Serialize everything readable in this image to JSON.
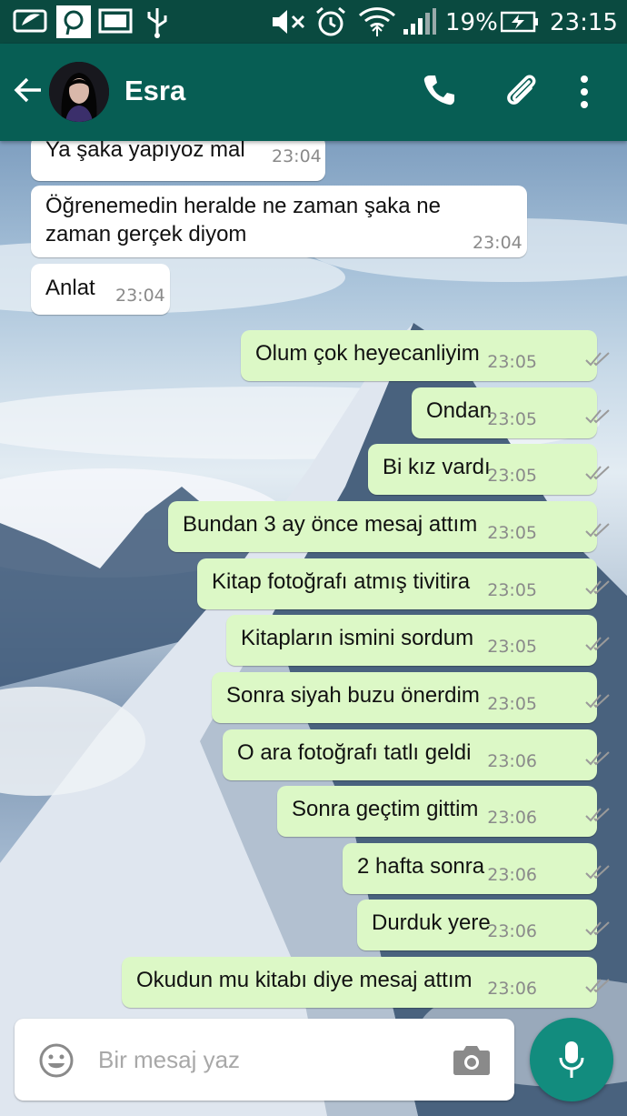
{
  "status_bar": {
    "battery": "19%",
    "time": "23:15"
  },
  "header": {
    "contact_name": "Esra"
  },
  "messages": [
    {
      "dir": "in",
      "text": "Ya şaka yapıyoz mal",
      "time": "23:04"
    },
    {
      "dir": "in",
      "text": "Öğrenemedin heralde ne zaman şaka ne",
      "text2": "zaman gerçek diyom",
      "time": "23:04"
    },
    {
      "dir": "in",
      "text": "Anlat",
      "time": "23:04"
    },
    {
      "dir": "out",
      "text": "Olum çok heyecanliyim",
      "time": "23:05"
    },
    {
      "dir": "out",
      "text": "Ondan",
      "time": "23:05"
    },
    {
      "dir": "out",
      "text": "Bi kız vardı",
      "time": "23:05"
    },
    {
      "dir": "out",
      "text": "Bundan 3 ay önce mesaj attım",
      "time": "23:05"
    },
    {
      "dir": "out",
      "text": "Kitap fotoğrafı atmış tivitira",
      "time": "23:05"
    },
    {
      "dir": "out",
      "text": "Kitapların ismini sordum",
      "time": "23:05"
    },
    {
      "dir": "out",
      "text": "Sonra siyah buzu önerdim",
      "time": "23:05"
    },
    {
      "dir": "out",
      "text": "O ara fotoğrafı tatlı  geldi",
      "time": "23:06"
    },
    {
      "dir": "out",
      "text": "Sonra geçtim gittim",
      "time": "23:06"
    },
    {
      "dir": "out",
      "text": "2 hafta sonra",
      "time": "23:06"
    },
    {
      "dir": "out",
      "text": "Durduk yere",
      "time": "23:06"
    },
    {
      "dir": "out",
      "text": "Okudun mu kitabı diye mesaj attım",
      "time": "23:06"
    }
  ],
  "composer": {
    "placeholder": "Bir mesaj yaz"
  },
  "icons": {
    "emoji": "emoji-icon",
    "camera": "camera-icon",
    "mic": "mic-icon",
    "call": "phone-icon",
    "attach": "paperclip-icon",
    "menu": "more-vert-icon"
  },
  "colors": {
    "header": "#075e54",
    "statusbar": "#0a4a40",
    "outgoing_bubble": "#dcf8c6",
    "incoming_bubble": "#ffffff",
    "mic_button": "#128c7e"
  }
}
